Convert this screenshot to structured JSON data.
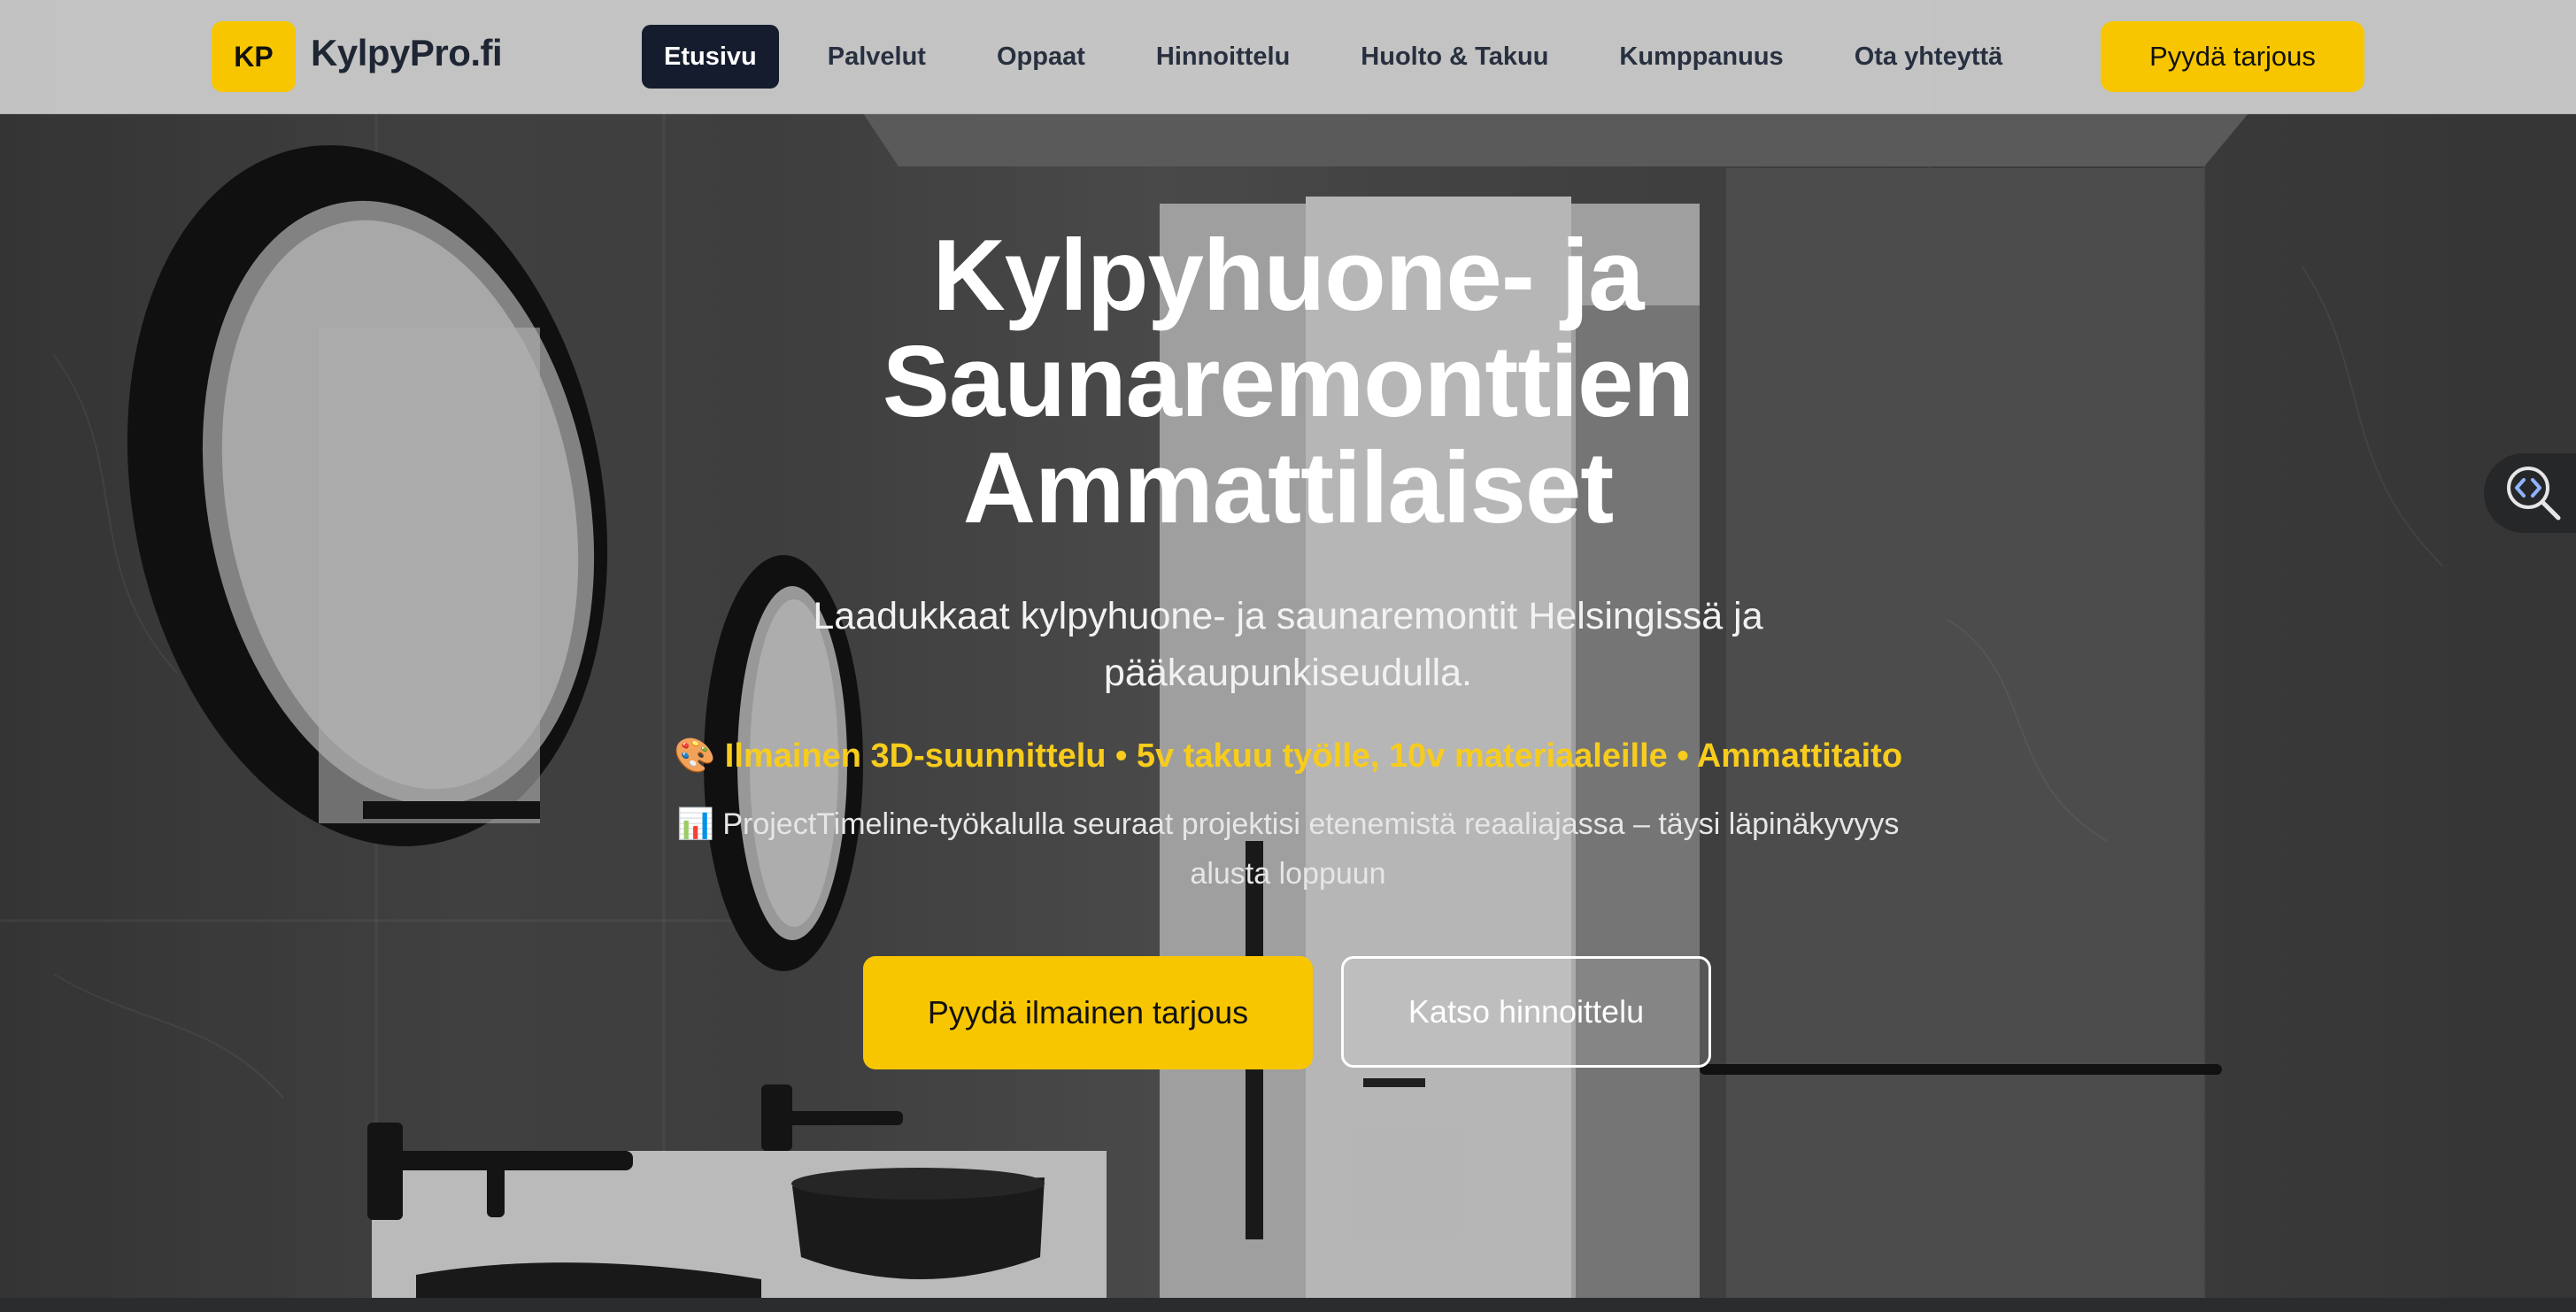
{
  "header": {
    "logo_badge": "KP",
    "logo_text": "KylpyPro.fi",
    "nav": [
      {
        "label": "Etusivu",
        "active": true
      },
      {
        "label": "Palvelut"
      },
      {
        "label": "Oppaat"
      },
      {
        "label": "Hinnoittelu"
      },
      {
        "label": "Huolto & Takuu"
      },
      {
        "label": "Kumppanuus"
      },
      {
        "label": "Ota yhteyttä"
      }
    ],
    "cta_label": "Pyydä tarjous"
  },
  "hero": {
    "title_lines": [
      "Kylpyhuone- ja",
      "Saunaremonttien",
      "Ammattilaiset"
    ],
    "subtitle_lines": [
      "Laadukkaat kylpyhuone- ja saunaremontit Helsingissä ja",
      "pääkaupunkiseudulla."
    ],
    "highlight": "🎨 Ilmainen 3D-suunnittelu • 5v takuu työlle, 10v materiaaleille • Ammattitaito",
    "note_lines": [
      "📊 ProjectTimeline-työkalulla seuraat projektisi etenemistä reaaliajassa – täysi läpinäkyvyys",
      "alusta loppuun"
    ],
    "primary_button": "Pyydä ilmainen tarjous",
    "secondary_button": "Katso hinnoittelu"
  },
  "colors": {
    "accent": "#f8c600",
    "nav_active_bg": "#141c2d",
    "highlight_text": "#f7cc1d"
  },
  "icons": {
    "inspect_widget": "code-search-icon"
  }
}
